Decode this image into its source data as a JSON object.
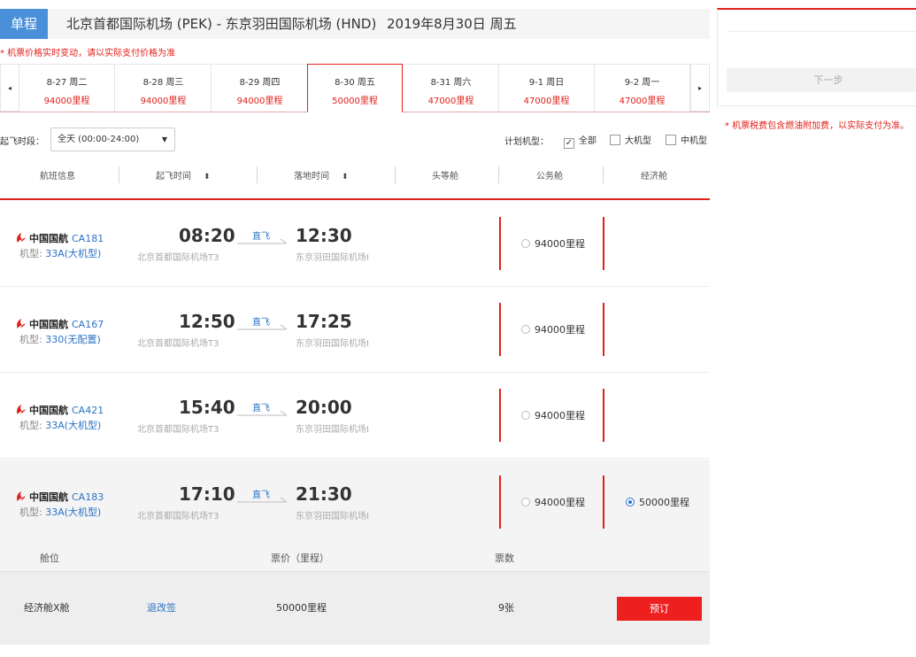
{
  "header": {
    "trip_type": "单程",
    "route": "北京首都国际机场 (PEK) - 东京羽田国际机场 (HND)",
    "date": "2019年8月30日 周五",
    "price_note": "* 机票价格实时变动，请以实际支付价格为准"
  },
  "date_strip": {
    "prev_icon": "◂",
    "next_icon": "▸",
    "dates": [
      {
        "date": "8-27 周二",
        "miles": "94000里程"
      },
      {
        "date": "8-28 周三",
        "miles": "94000里程"
      },
      {
        "date": "8-29 周四",
        "miles": "94000里程"
      },
      {
        "date": "8-30 周五",
        "miles": "50000里程"
      },
      {
        "date": "8-31 周六",
        "miles": "47000里程"
      },
      {
        "date": "9-1 周日",
        "miles": "47000里程"
      },
      {
        "date": "9-2 周一",
        "miles": "47000里程"
      }
    ]
  },
  "filters": {
    "time_label": "起飞时段：",
    "time_value": "全天 (00:00-24:00)",
    "plan_label": "计划机型：",
    "options": [
      {
        "label": "全部",
        "checked": true
      },
      {
        "label": "大机型",
        "checked": false
      },
      {
        "label": "中机型",
        "checked": false
      }
    ]
  },
  "columns": {
    "flight_info": "航班信息",
    "dep_time": "起飞时间",
    "arr_time": "落地时间",
    "first": "头等舱",
    "business": "公务舱",
    "economy": "经济舱"
  },
  "flights": [
    {
      "airline": "中国国航",
      "flight_no": "CA181",
      "plane_label": "机型:",
      "plane_type": "33A(大机型)",
      "dep_time": "08:20",
      "dep_airport": "北京首都国际机场T3",
      "direct": "直飞",
      "arr_time": "12:30",
      "arr_airport": "东京羽田国际机场I",
      "business": "94000里程",
      "economy": ""
    },
    {
      "airline": "中国国航",
      "flight_no": "CA167",
      "plane_label": "机型:",
      "plane_type": "330(无配置)",
      "dep_time": "12:50",
      "dep_airport": "北京首都国际机场T3",
      "direct": "直飞",
      "arr_time": "17:25",
      "arr_airport": "东京羽田国际机场I",
      "business": "94000里程",
      "economy": ""
    },
    {
      "airline": "中国国航",
      "flight_no": "CA421",
      "plane_label": "机型:",
      "plane_type": "33A(大机型)",
      "dep_time": "15:40",
      "dep_airport": "北京首都国际机场T3",
      "direct": "直飞",
      "arr_time": "20:00",
      "arr_airport": "东京羽田国际机场I",
      "business": "94000里程",
      "economy": ""
    },
    {
      "airline": "中国国航",
      "flight_no": "CA183",
      "plane_label": "机型:",
      "plane_type": "33A(大机型)",
      "dep_time": "17:10",
      "dep_airport": "北京首都国际机场T3",
      "direct": "直飞",
      "arr_time": "21:30",
      "arr_airport": "东京羽田国际机场I",
      "business": "94000里程",
      "economy": "50000里程"
    }
  ],
  "cabin_detail": {
    "headers": {
      "cabin": "舱位",
      "price": "票价（里程）",
      "tickets": "票数"
    },
    "row": {
      "cabin": "经济舱X舱",
      "rule": "退改签",
      "price": "50000里程",
      "tickets": "9张",
      "book": "预订"
    }
  },
  "side_panel": {
    "next_button": "下一步",
    "tax_note": "* 机票税费包含燃油附加费，以实际支付为准。"
  },
  "colors": {
    "accent_red": "#e0201a",
    "link_blue": "#2b72c4",
    "trip_type_blue": "#4a90d9"
  }
}
